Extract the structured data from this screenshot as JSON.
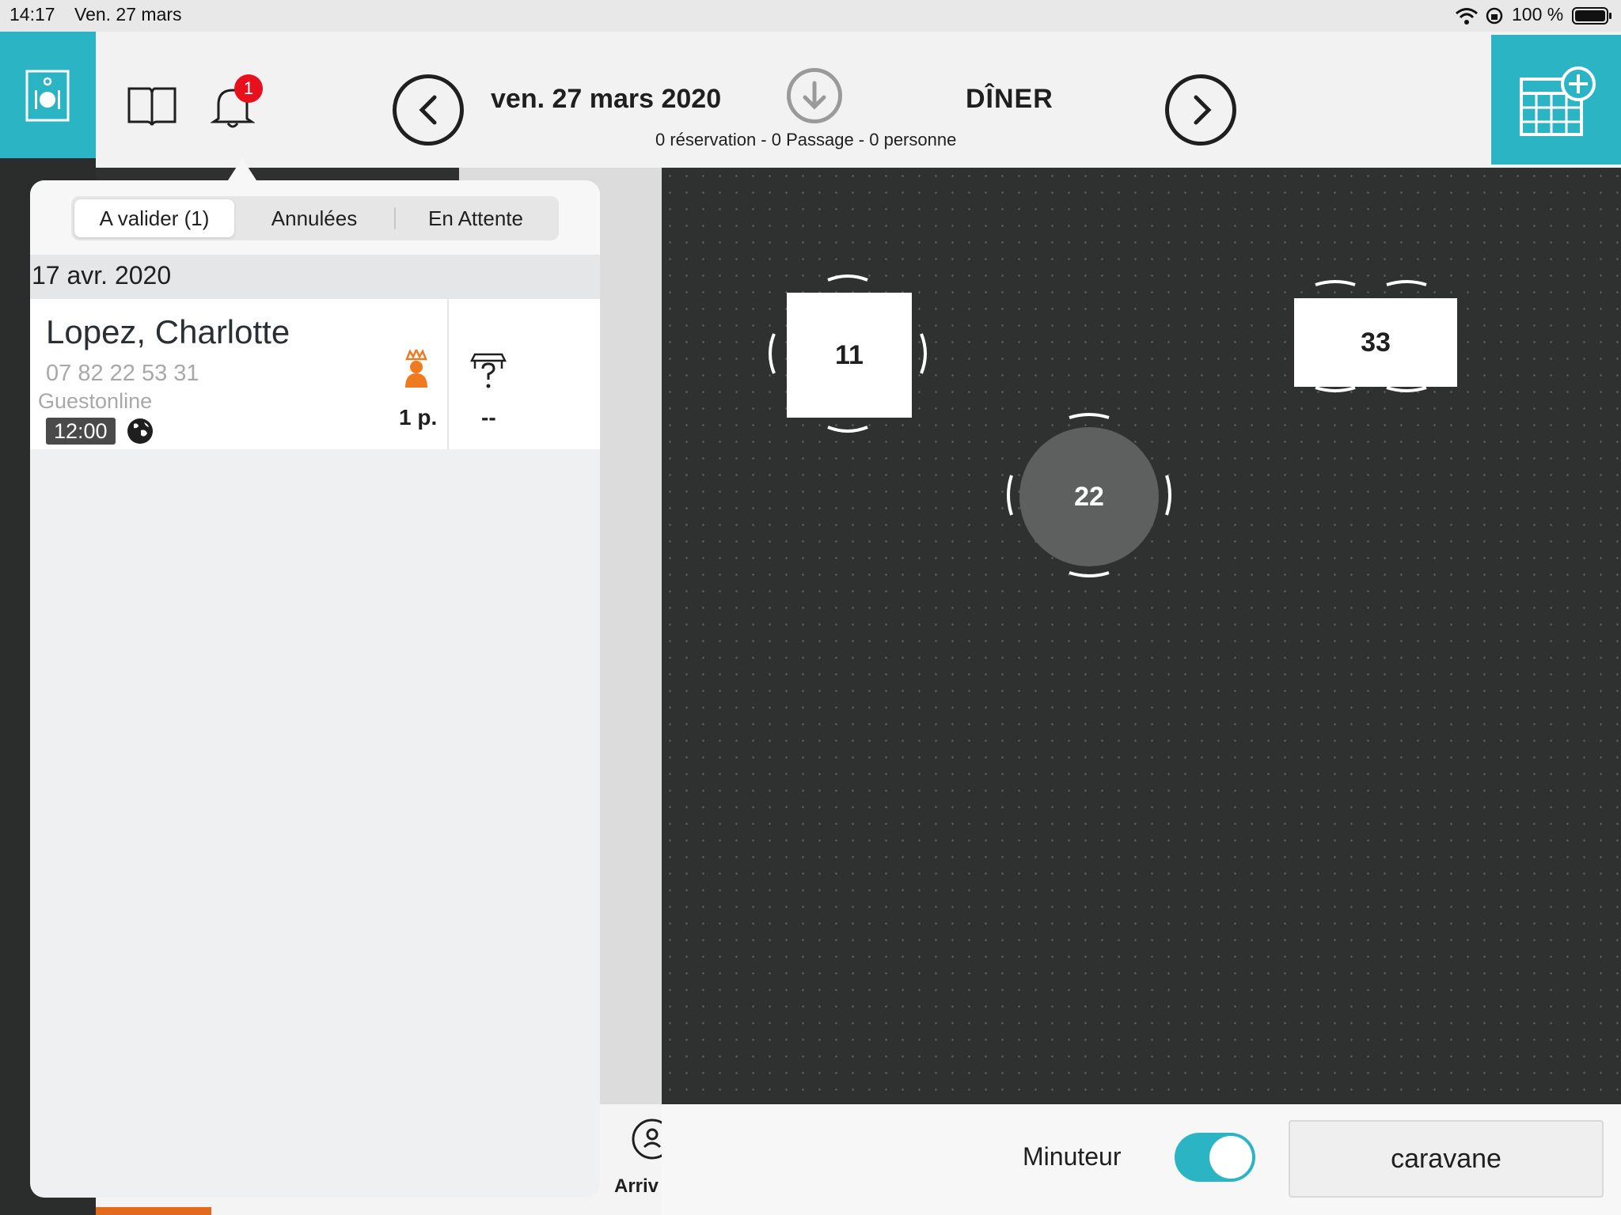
{
  "status_bar": {
    "time": "14:17",
    "date": "Ven. 27 mars",
    "battery": "100 %",
    "icons": [
      "wifi-icon",
      "orientation-lock-icon",
      "battery-icon"
    ]
  },
  "header": {
    "date": "ven. 27 mars 2020",
    "service": "DÎNER",
    "summary": "0 réservation - 0 Passage - 0 personne",
    "notification_count": "1",
    "icons": [
      "restaurant-logo-icon",
      "book-icon",
      "bell-icon",
      "chevron-left-icon",
      "download-icon",
      "chevron-right-icon",
      "calendar-add-icon"
    ]
  },
  "popover": {
    "tabs": [
      {
        "label": "A valider (1)",
        "active": true
      },
      {
        "label": "Annulées",
        "active": false
      },
      {
        "label": "En Attente",
        "active": false
      }
    ],
    "section_date": "17 avr. 2020",
    "reservation": {
      "name": "Lopez, Charlotte",
      "phone": "07 82 22 53 31",
      "source": "Guestonline",
      "time": "12:00",
      "party_size": "1 p.",
      "table": "--"
    }
  },
  "floor_plan": {
    "tables": [
      {
        "number": "11",
        "shape": "square"
      },
      {
        "number": "22",
        "shape": "round"
      },
      {
        "number": "33",
        "shape": "rectangle"
      }
    ]
  },
  "bottom_bar": {
    "timer_label": "Minuteur",
    "timer_enabled": true,
    "room_label": "caravane",
    "arrival_label": "Arriv"
  },
  "colors": {
    "accent": "#2bb4c4",
    "notification": "#e8101c",
    "vip": "#f07a20",
    "floor": "#2f3030"
  }
}
